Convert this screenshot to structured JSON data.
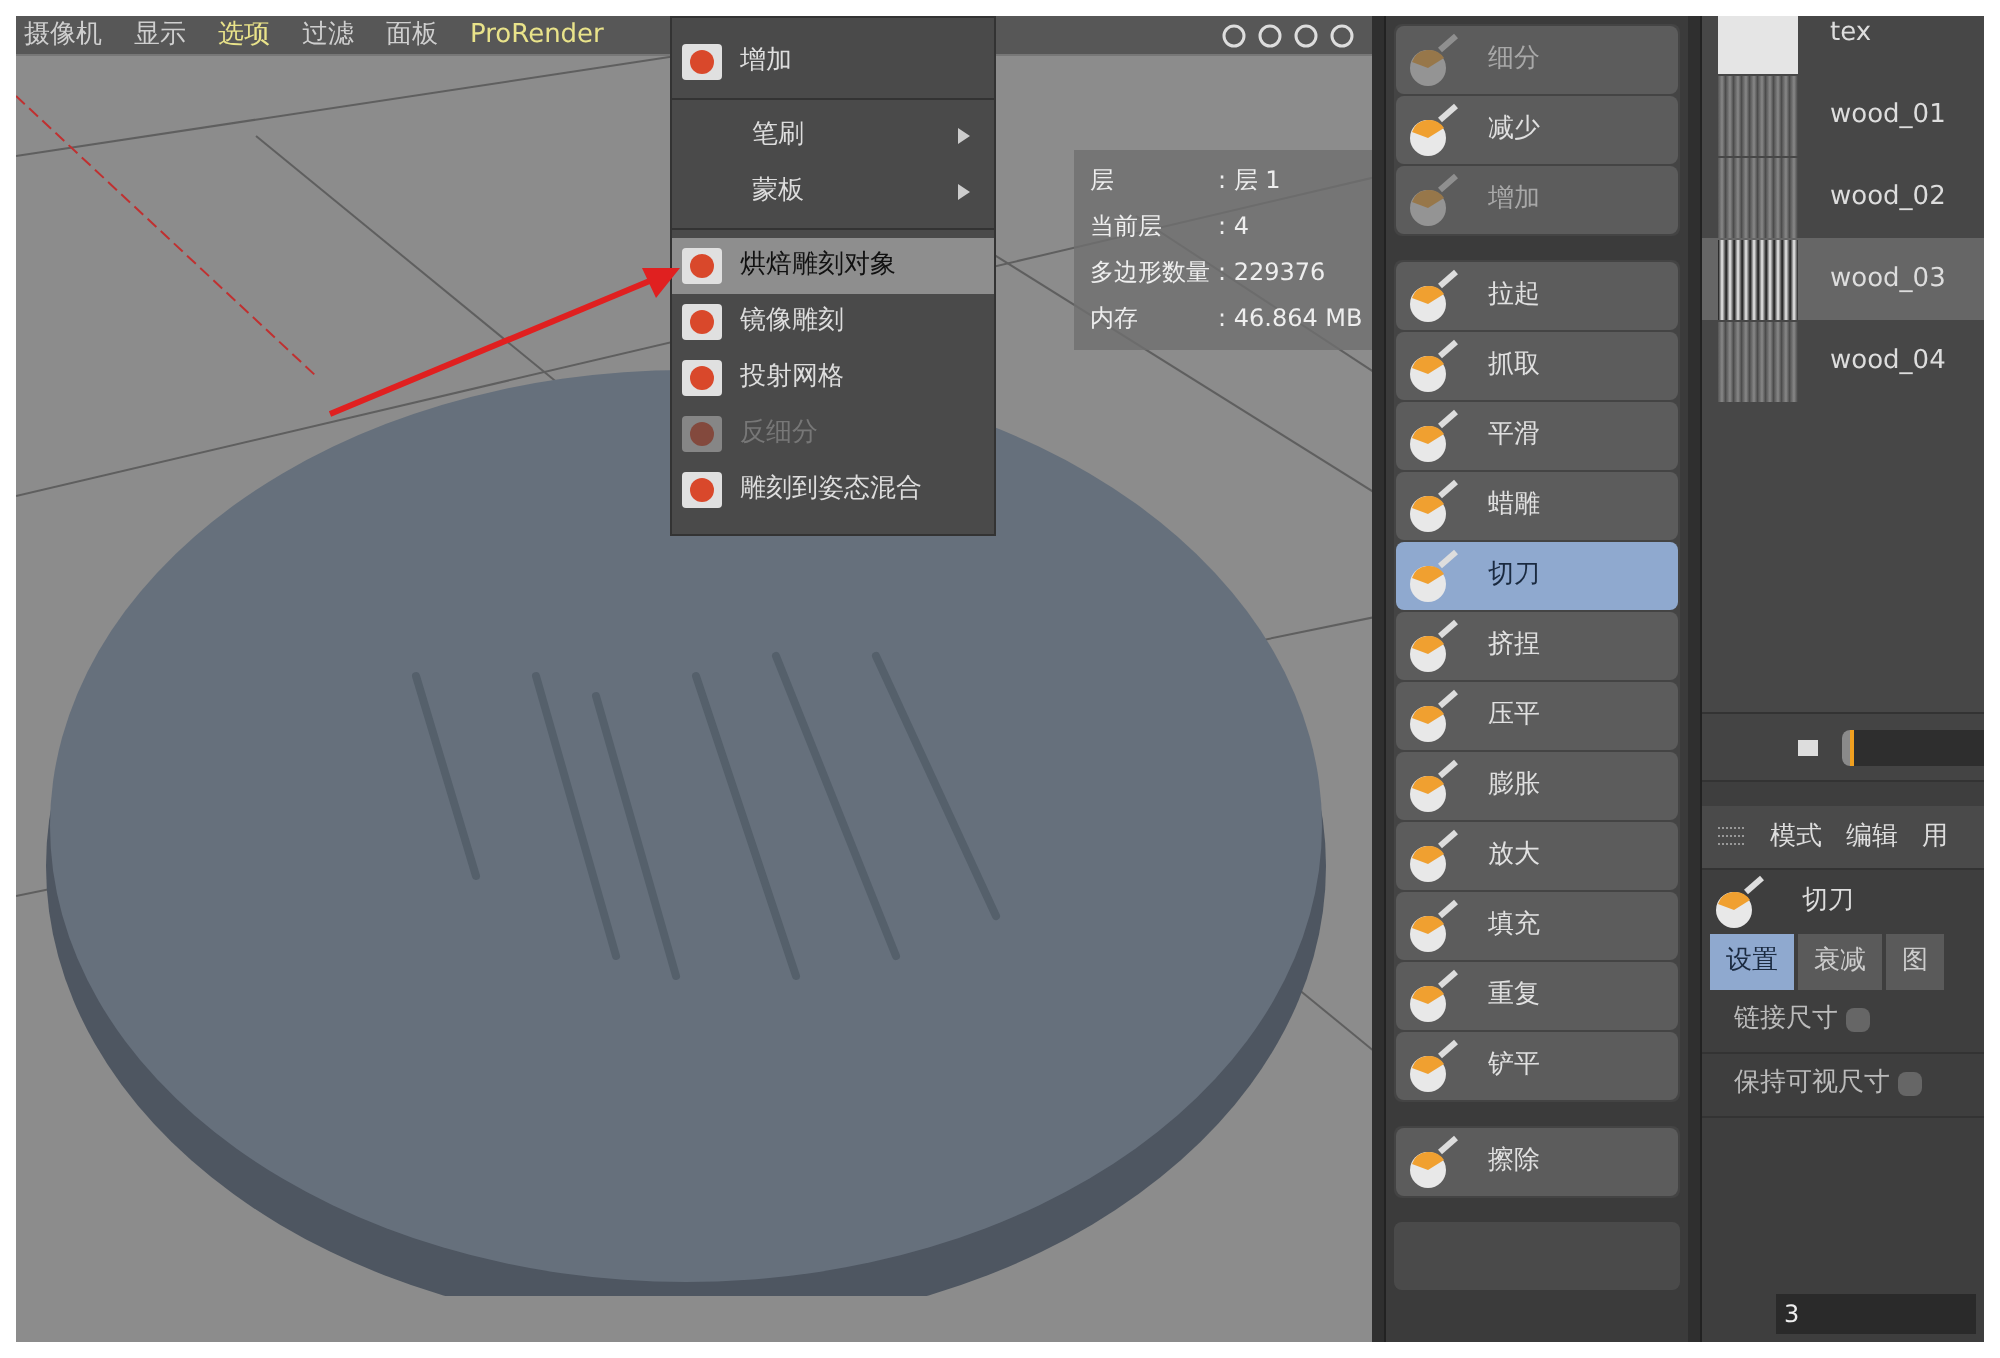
{
  "viewport": {
    "menu_bar": [
      {
        "label": "摄像机",
        "highlighted": false
      },
      {
        "label": "显示",
        "highlighted": false
      },
      {
        "label": "选项",
        "highlighted": true
      },
      {
        "label": "过滤",
        "highlighted": false
      },
      {
        "label": "面板",
        "highlighted": false
      },
      {
        "label": "ProRender",
        "highlighted": true
      }
    ],
    "context_menu": [
      {
        "kind": "tool",
        "label": "增加",
        "highlighted": false,
        "disabled": false
      },
      {
        "kind": "separator"
      },
      {
        "kind": "submenu",
        "label": "笔刷"
      },
      {
        "kind": "submenu",
        "label": "蒙板"
      },
      {
        "kind": "separator"
      },
      {
        "kind": "tool",
        "label": "烘焙雕刻对象",
        "highlighted": true,
        "disabled": false
      },
      {
        "kind": "tool",
        "label": "镜像雕刻",
        "highlighted": false,
        "disabled": false
      },
      {
        "kind": "tool",
        "label": "投射网格",
        "highlighted": false,
        "disabled": false
      },
      {
        "kind": "tool",
        "label": "反细分",
        "highlighted": false,
        "disabled": true
      },
      {
        "kind": "tool",
        "label": "雕刻到姿态混合",
        "highlighted": false,
        "disabled": false
      }
    ],
    "info": [
      {
        "label": "层",
        "value": ": 层 1"
      },
      {
        "label": "当前层",
        "value": ": 4"
      },
      {
        "label": "多边形数量",
        "value": ": 229376"
      },
      {
        "label": "内存",
        "value": ": 46.864 MB"
      }
    ]
  },
  "tool_groups": [
    {
      "items": [
        {
          "label": "细分",
          "selected": false,
          "disabled": true
        },
        {
          "label": "减少",
          "selected": false,
          "disabled": false
        },
        {
          "label": "增加",
          "selected": false,
          "disabled": true
        }
      ]
    },
    {
      "items": [
        {
          "label": "拉起",
          "selected": false,
          "disabled": false
        },
        {
          "label": "抓取",
          "selected": false,
          "disabled": false
        },
        {
          "label": "平滑",
          "selected": false,
          "disabled": false
        },
        {
          "label": "蜡雕",
          "selected": false,
          "disabled": false
        },
        {
          "label": "切刀",
          "selected": true,
          "disabled": false
        },
        {
          "label": "挤捏",
          "selected": false,
          "disabled": false
        },
        {
          "label": "压平",
          "selected": false,
          "disabled": false
        },
        {
          "label": "膨胀",
          "selected": false,
          "disabled": false
        },
        {
          "label": "放大",
          "selected": false,
          "disabled": false
        },
        {
          "label": "填充",
          "selected": false,
          "disabled": false
        },
        {
          "label": "重复",
          "selected": false,
          "disabled": false
        },
        {
          "label": "铲平",
          "selected": false,
          "disabled": false
        }
      ]
    },
    {
      "items": [
        {
          "label": "擦除",
          "selected": false,
          "disabled": false
        }
      ]
    }
  ],
  "textures": [
    {
      "name": "tex",
      "selected": false
    },
    {
      "name": "wood_01",
      "selected": false
    },
    {
      "name": "wood_02",
      "selected": false
    },
    {
      "name": "wood_03",
      "selected": true
    },
    {
      "name": "wood_04",
      "selected": false
    }
  ],
  "timeline": {
    "level": 0.08
  },
  "attributes": {
    "menu": [
      "模式",
      "编辑",
      "用"
    ],
    "tool_name": "切刀",
    "tabs": [
      {
        "label": "设置",
        "selected": true
      },
      {
        "label": "衰减",
        "selected": false
      },
      {
        "label": "图",
        "selected": false
      }
    ],
    "options": [
      {
        "label": "链接尺寸",
        "checked": false
      },
      {
        "label": "保持可视尺寸",
        "checked": false
      }
    ],
    "field_value": "3"
  }
}
